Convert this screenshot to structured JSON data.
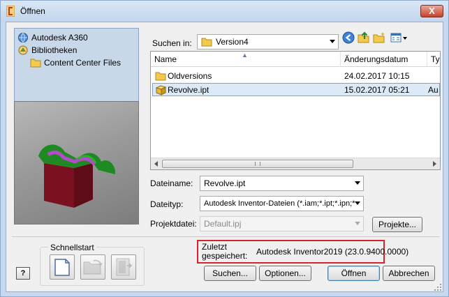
{
  "window": {
    "title": "Öffnen",
    "close_label": "X"
  },
  "library": {
    "items": [
      {
        "label": "Autodesk A360",
        "icon": "a360-globe-icon"
      },
      {
        "label": "Bibliotheken",
        "icon": "library-icon"
      },
      {
        "label": "Content Center Files",
        "icon": "folder-icon"
      }
    ]
  },
  "search_in": {
    "label": "Suchen in:",
    "value": "Version4"
  },
  "file_list": {
    "columns": [
      "Name",
      "Änderungsdatum",
      "Ty"
    ],
    "rows": [
      {
        "name": "Oldversions",
        "date": "24.02.2017 10:15",
        "type": "",
        "icon": "folder-icon",
        "selected": false
      },
      {
        "name": "Revolve.ipt",
        "date": "15.02.2017 05:21",
        "type": "Au",
        "icon": "inventor-part-icon",
        "selected": true
      }
    ]
  },
  "filename": {
    "label": "Dateiname:",
    "value": "Revolve.ipt"
  },
  "filetype": {
    "label": "Dateityp:",
    "value": "Autodesk Inventor-Dateien (*.iam;*.ipt;*.ipn;*"
  },
  "project": {
    "label": "Projektdatei:",
    "value": "Default.ipj",
    "button": "Projekte..."
  },
  "quickstart": {
    "label": "Schnellstart"
  },
  "last_saved": {
    "label": "Zuletzt gespeichert:",
    "value": "Autodesk Inventor2019 (23.0.9400.0000)"
  },
  "buttons": {
    "search": "Suchen...",
    "options": "Optionen...",
    "open": "Öffnen",
    "cancel": "Abbrechen",
    "help": "?"
  },
  "colors": {
    "accent": "#3c7fb1",
    "highlight_box": "#d9232a",
    "selection": "#dce9f7"
  }
}
